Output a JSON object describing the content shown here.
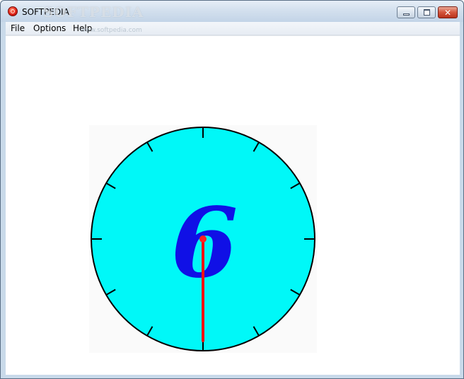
{
  "window": {
    "title": "SOFTPEDIA",
    "watermark": "SOFTPEDIA",
    "watermark_sub": "www.softpedia.com",
    "close_glyph": "✕"
  },
  "menu": {
    "items": [
      {
        "label": "File"
      },
      {
        "label": "Options"
      },
      {
        "label": "Help"
      }
    ]
  },
  "clock": {
    "displayed_number": "6",
    "hour_marks": 12,
    "hand_angle_degrees": 180,
    "colors": {
      "face": "#00f8f8",
      "outline": "#000000",
      "ticks": "#000000",
      "numeral": "#1010e6",
      "hand": "#ee1111",
      "hub": "#ff2222",
      "panel_bg": "#fafafa"
    }
  }
}
